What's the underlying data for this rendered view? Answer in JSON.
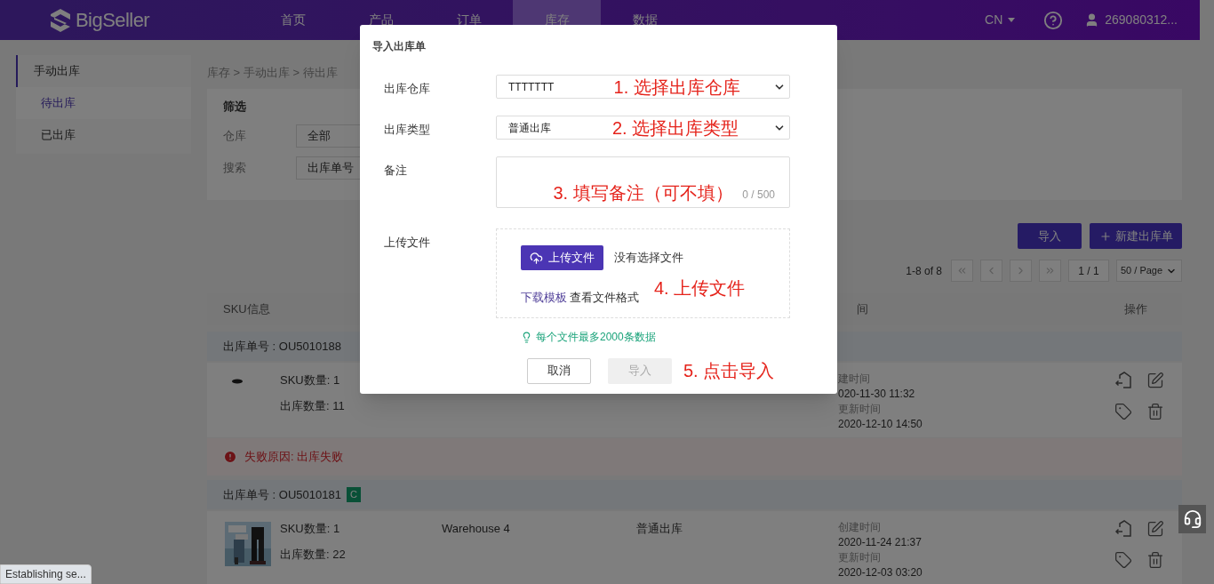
{
  "header": {
    "logo": "BigSeller",
    "nav": [
      {
        "label": "首页",
        "selected": false
      },
      {
        "label": "产品",
        "selected": false
      },
      {
        "label": "订单",
        "selected": false
      },
      {
        "label": "库存",
        "selected": true
      },
      {
        "label": "数据",
        "selected": false
      }
    ],
    "language": "CN",
    "user": "269080312..."
  },
  "sidebar": {
    "items": [
      {
        "label": "手动出库",
        "expanded": true,
        "children": [
          {
            "label": "待出库",
            "selected": true
          },
          {
            "label": "已出库",
            "selected": false
          }
        ]
      }
    ]
  },
  "breadcrumb": "库存 > 手动出库 > 待出库",
  "filter": {
    "title": "筛选",
    "fields": [
      {
        "label": "仓库",
        "value": "全部"
      },
      {
        "label": "搜索",
        "value": "出库单号"
      }
    ]
  },
  "actions": [
    {
      "label": "导入",
      "kind": "plain"
    },
    {
      "label": "新建出库单",
      "kind": "add"
    }
  ],
  "pagination": {
    "range": "1-8 of 8",
    "page": "1 / 1",
    "page_size": "50 / Page"
  },
  "table": {
    "columns": [
      "SKU信息",
      "间",
      "操作"
    ],
    "groups": [
      {
        "order_no": "出库单号 : OU5010188",
        "kind": "icon",
        "sku_count": "SKU数量: 1",
        "out_qty": "出库数量: 11",
        "created_label": "建时间",
        "created": "020-11-30 11:32",
        "updated_label": "更新时间",
        "updated": "2020-12-10 14:50",
        "error": "失败原因: 出库失败"
      },
      {
        "order_no": "出库单号 : OU5010181",
        "badge": "C",
        "kind": "picture",
        "sku_count": "SKU数量: 1",
        "out_qty": "出库数量: 22",
        "warehouse": "Warehouse 4",
        "type": "普通出库",
        "created_label": "创建时间",
        "created": "2020-11-24 21:37",
        "updated_label": "更新时间",
        "updated": "2020-12-03 03:20"
      }
    ]
  },
  "dialog": {
    "title": "导入出库单",
    "fields": [
      {
        "label": "出库仓库",
        "kind": "select",
        "value": "TTTTTTT",
        "annotation": "1. 选择出库仓库"
      },
      {
        "label": "出库类型",
        "kind": "select",
        "value": "普通出库",
        "annotation": "2. 选择出库类型"
      },
      {
        "label": "备注",
        "kind": "textarea",
        "counter": "0 / 500",
        "annotation": "3. 填写备注（可不填）"
      },
      {
        "label": "上传文件",
        "kind": "upload",
        "button": "上传文件",
        "file_status": "没有选择文件",
        "template_link": "下载模板",
        "format_text": "查看文件格式",
        "annotation": "4. 上传文件"
      }
    ],
    "hint": "每个文件最多2000条数据",
    "buttons": [
      {
        "label": "取消",
        "disabled": false
      },
      {
        "label": "导入",
        "disabled": true
      }
    ],
    "footer_annotation": "5. 点击导入"
  },
  "status_popup": "Establishing se..."
}
